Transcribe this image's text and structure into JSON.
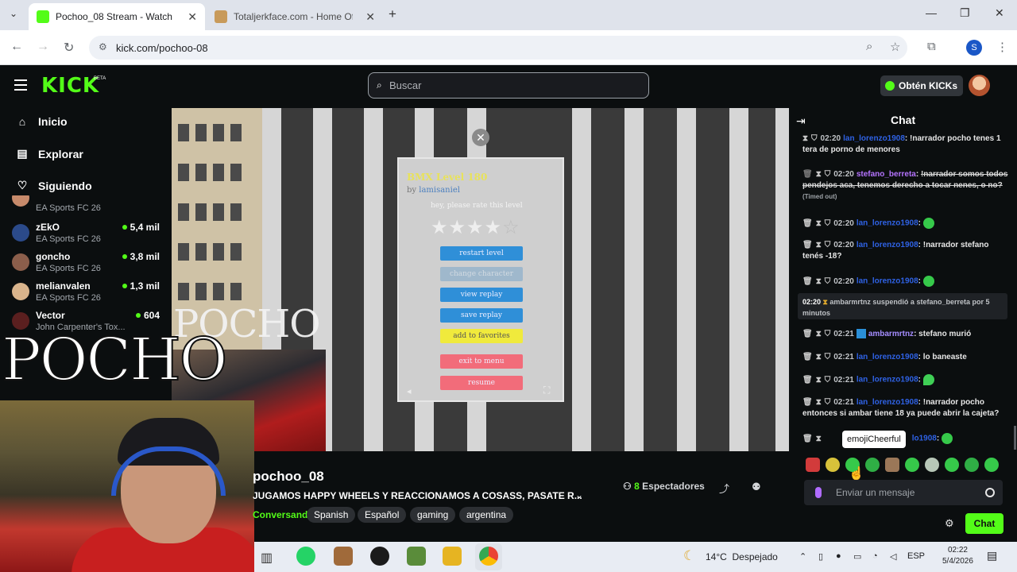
{
  "browser": {
    "tabs": [
      {
        "title": "Pochoo_08 Stream - Watch Live",
        "close": "✕"
      },
      {
        "title": "Totaljerkface.com - Home Of H",
        "close": "✕"
      }
    ],
    "new_tab": "+",
    "url": "kick.com/pochoo-08",
    "window": {
      "minimize": "—",
      "maximize": "❐",
      "close": "✕"
    },
    "profile_initial": "S"
  },
  "kick": {
    "logo": "KICK",
    "logo_badge": "BETA",
    "search_placeholder": "Buscar",
    "get_kicks": "Obtén KICKs",
    "colors": {
      "accent": "#53fc18",
      "background": "#0b0e0f"
    }
  },
  "sidebar": {
    "nav": [
      {
        "label": "Inicio",
        "icon": "home-icon"
      },
      {
        "label": "Explorar",
        "icon": "browse-icon"
      },
      {
        "label": "Siguiendo",
        "icon": "heart-icon"
      }
    ],
    "partial_category": "EA Sports FC 26",
    "channels": [
      {
        "name": "zEkO",
        "game": "EA Sports FC 26",
        "viewers": "5,4 mil"
      },
      {
        "name": "goncho",
        "game": "EA Sports FC 26",
        "viewers": "3,8 mil"
      },
      {
        "name": "melianvalen",
        "game": "EA Sports FC 26",
        "viewers": "1,3 mil"
      },
      {
        "name": "Vector",
        "game": "John Carpenter's Tox...",
        "viewers": "604"
      }
    ]
  },
  "video": {
    "overlay_big": "POCHO",
    "overlay_small": "POCHO",
    "game": {
      "title": "BMX Level 180",
      "by_prefix": "by",
      "author": "lamisaniel",
      "rate_prompt": "hey, please rate this level",
      "rating": 4,
      "rating_max": 5,
      "buttons": [
        "restart level",
        "change character",
        "view replay",
        "save replay",
        "add to favorites",
        "exit to menu",
        "resume"
      ]
    }
  },
  "stream": {
    "name": "pochoo_08",
    "title": "JUGAMOS HAPPY WHEELS Y REACCIONAMOS A COSASS, PASATE R...",
    "category": "Conversando",
    "tags": [
      "Spanish",
      "Español",
      "gaming",
      "argentina"
    ],
    "viewers_count": "8",
    "viewers_label": "Espectadores"
  },
  "chat": {
    "title": "Chat",
    "messages": [
      {
        "time": "02:20",
        "user": "lan_lorenzo1908",
        "text": "!narrador pocho tenes 1 tera de porno de menores"
      },
      {
        "time": "02:20",
        "user": "stefano_berreta",
        "text": "!narrador somos todos pendejos aca, tenemos derecho a tocar nenes, o no?",
        "note": "(Timed out)"
      },
      {
        "time": "02:20",
        "user": "lan_lorenzo1908",
        "text": ""
      },
      {
        "time": "02:20",
        "user": "lan_lorenzo1908",
        "text": "!narrador stefano tenés -18?"
      },
      {
        "time": "02:20",
        "user": "lan_lorenzo1908",
        "text": ""
      },
      {
        "time": "02:21",
        "user": "ambarmrtnz",
        "text": "stefano murió"
      },
      {
        "time": "02:21",
        "user": "lan_lorenzo1908",
        "text": "lo baneaste"
      },
      {
        "time": "02:21",
        "user": "lan_lorenzo1908",
        "text": ""
      },
      {
        "time": "02:21",
        "user": "lan_lorenzo1908",
        "text": "!narrador pocho entonces si ambar tiene 18 ya puede abrir la cajeta?"
      },
      {
        "time": "",
        "user": "lo1908",
        "text": ""
      }
    ],
    "system": {
      "time": "02:20",
      "actor": "ambarmrtnz",
      "action": "suspendió a",
      "target": "stefano_berreta",
      "suffix": "por 5 minutos"
    },
    "tooltip": "emojiCheerful",
    "input_placeholder": "Enviar un mensaje",
    "send_label": "Chat"
  },
  "taskbar": {
    "weather_temp": "14°C",
    "weather_text": "Despejado",
    "lang": "ESP",
    "time": "02:22",
    "date": "5/4/2026"
  }
}
